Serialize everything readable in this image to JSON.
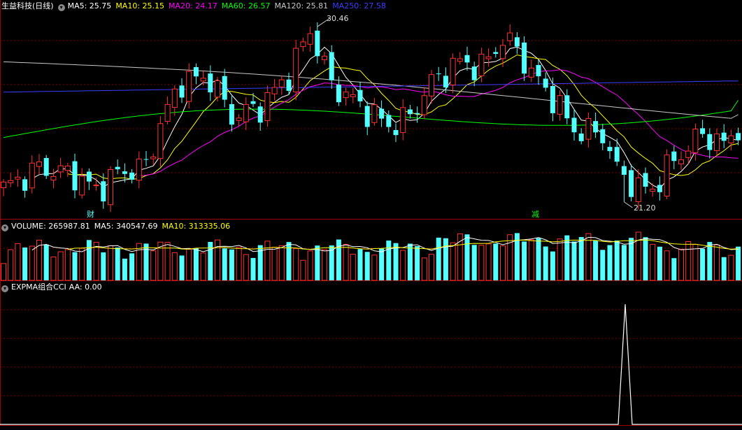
{
  "header": {
    "stock": "生益科技(日线)",
    "ma5": "MA5: 25.75",
    "ma10": "MA10: 25.15",
    "ma20": "MA20: 24.17",
    "ma60": "MA60: 26.57",
    "ma120": "MA120: 25.81",
    "ma250": "MA250: 27.58"
  },
  "volume_header": {
    "label": "VOLUME: 265987.81",
    "ma5": "MA5: 340547.69",
    "ma10": "MA10: 313335.06"
  },
  "indicator_header": {
    "label": "EXPMA组合CCI",
    "aa": "AA: 0.00"
  },
  "annotations": {
    "high_label": "30.46",
    "low_label": "21.20",
    "event_1": "财",
    "event_2": "减"
  },
  "colors": {
    "up": "#ff3232",
    "down": "#54ffff",
    "ma5": "#ffffff",
    "ma10": "#ffff00",
    "ma20": "#ff00ff",
    "ma60": "#00ff00",
    "ma120": "#c8c8c8",
    "ma250": "#3c3cff",
    "grid": "#800000"
  },
  "chart_data": [
    {
      "type": "candlestick",
      "title": "生益科技(日线)",
      "ylim": [
        20.6,
        31.2
      ],
      "high": 30.46,
      "low": 21.2,
      "series_names": [
        "MA5",
        "MA10",
        "MA20",
        "MA60",
        "MA120",
        "MA250"
      ],
      "latest": {
        "MA5": 25.75,
        "MA10": 25.15,
        "MA20": 24.17,
        "MA60": 26.57,
        "MA120": 25.81,
        "MA250": 27.58
      }
    },
    {
      "type": "bar",
      "title": "VOLUME",
      "latest": {
        "VOLUME": 265987.81,
        "MA5": 340547.69,
        "MA10": 313335.06
      }
    },
    {
      "type": "line",
      "title": "EXPMA组合CCI",
      "latest": {
        "AA": 0.0
      },
      "spike_value": 1,
      "ylim": [
        0,
        1.1
      ]
    }
  ]
}
